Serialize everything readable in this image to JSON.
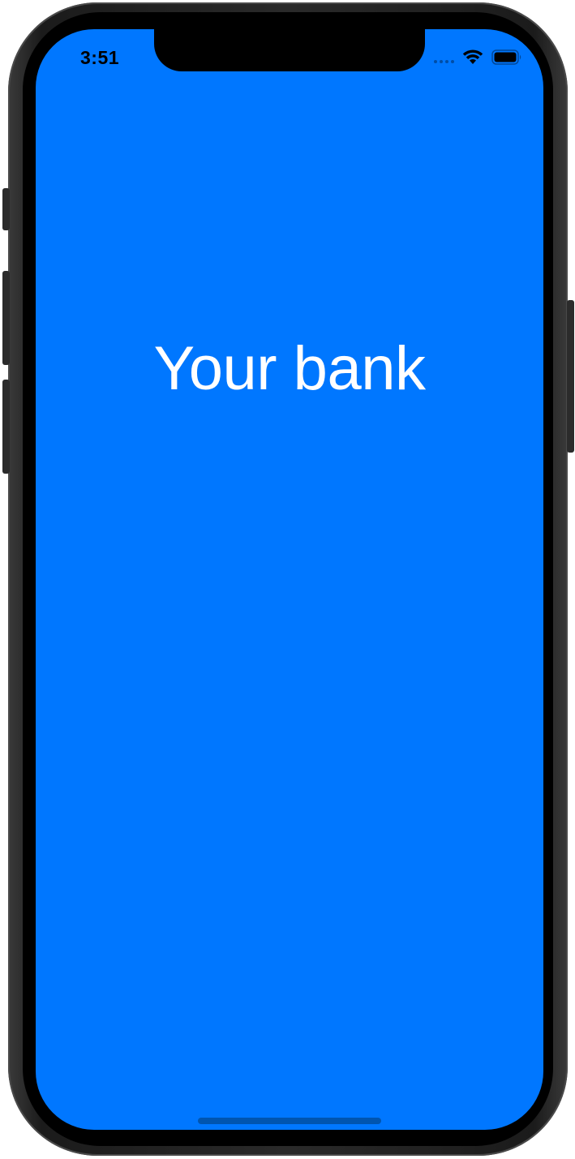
{
  "status_bar": {
    "time": "3:51",
    "signal_icon": "cellular-signal-icon",
    "wifi_icon": "wifi-icon",
    "battery_icon": "battery-icon"
  },
  "splash": {
    "title": "Your bank"
  },
  "colors": {
    "screen_background": "#0077FF",
    "title_text": "#FFFFFF",
    "home_indicator": "#0055B0",
    "device_frame": "#000000"
  }
}
